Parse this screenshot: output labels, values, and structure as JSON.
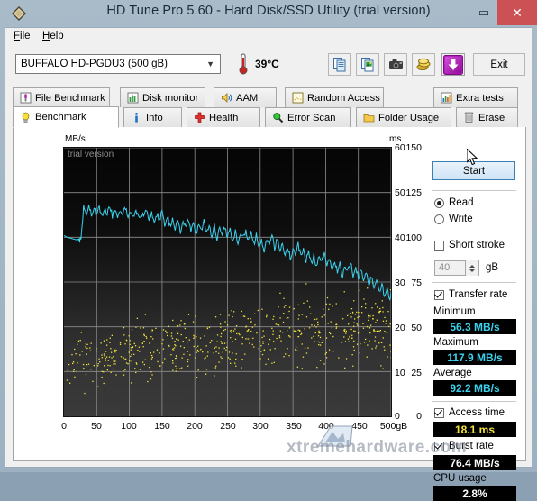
{
  "window": {
    "title": "HD Tune Pro 5.60 - Hard Disk/SSD Utility (trial version)",
    "app_icon": "diamond-icon",
    "minimize": "–",
    "maximize": "▭",
    "close": "✕"
  },
  "menu": {
    "items": [
      {
        "label": "File",
        "mnemonic": "F"
      },
      {
        "label": "Help",
        "mnemonic": "H"
      }
    ]
  },
  "toolbar": {
    "drive_selected": "BUFFALO HD-PGDU3 (500 gB)",
    "drive_chevron": "chevron-down-icon",
    "temperature": "39°C",
    "thermometer_icon": "thermometer-icon",
    "buttons": [
      {
        "name": "copy-text-icon",
        "tip": "Copy text"
      },
      {
        "name": "copy-image-icon",
        "tip": "Copy image"
      },
      {
        "name": "camera-icon",
        "tip": "Screenshot"
      },
      {
        "name": "coins-icon",
        "tip": "Buy"
      },
      {
        "name": "download-arrow-icon",
        "tip": "Download"
      }
    ],
    "exit_label": "Exit"
  },
  "tabs": {
    "row1": [
      {
        "label": "File Benchmark",
        "icon": "flask-icon",
        "active": false
      },
      {
        "label": "Disk monitor",
        "icon": "bar-chart-icon",
        "active": false
      },
      {
        "label": "AAM",
        "icon": "speaker-icon",
        "active": false
      },
      {
        "label": "Random Access",
        "icon": "dots-icon",
        "active": false
      },
      {
        "label": "Extra tests",
        "icon": "chart-icon",
        "active": false
      }
    ],
    "row2": [
      {
        "label": "Benchmark",
        "icon": "bulb-icon",
        "active": true
      },
      {
        "label": "Info",
        "icon": "info-icon",
        "active": false
      },
      {
        "label": "Health",
        "icon": "red-cross-icon",
        "active": false
      },
      {
        "label": "Error Scan",
        "icon": "magnifier-icon",
        "active": false
      },
      {
        "label": "Folder Usage",
        "icon": "folder-icon",
        "active": false
      },
      {
        "label": "Erase",
        "icon": "trash-icon",
        "active": false
      }
    ]
  },
  "controls": {
    "start_label": "Start",
    "mode": {
      "read_label": "Read",
      "write_label": "Write",
      "selected": "Read"
    },
    "short_stroke": {
      "label": "Short stroke",
      "checked": false,
      "size_value": "40",
      "size_unit": "gB"
    },
    "transfer_rate": {
      "label": "Transfer rate",
      "checked": true,
      "minimum_label": "Minimum",
      "minimum_value": "56.3 MB/s",
      "maximum_label": "Maximum",
      "maximum_value": "117.9 MB/s",
      "average_label": "Average",
      "average_value": "92.2 MB/s"
    },
    "access_time": {
      "label": "Access time",
      "checked": true,
      "value": "18.1 ms"
    },
    "burst_rate": {
      "label": "Burst rate",
      "checked": true,
      "value": "76.4 MB/s"
    },
    "cpu_usage": {
      "label": "CPU usage",
      "value": "2.8%"
    },
    "colors": {
      "transfer_rate": "#3ad2ee",
      "access_time": "#f5e43c",
      "burst_rate": "#ffffff",
      "cpu_usage": "#ffffff",
      "accent": "#3c7fb1",
      "close_button": "#cb5154"
    }
  },
  "watermark": {
    "plot_label": "trial version",
    "site": "xtremehardware.com"
  },
  "chart_data": {
    "type": "line",
    "title": "",
    "xlabel": "gB",
    "ylabel": "MB/s",
    "y2label": "ms",
    "xlim": [
      0,
      500
    ],
    "ylim": [
      0,
      150
    ],
    "y2lim": [
      0,
      60
    ],
    "grid": true,
    "x_ticks": [
      0,
      50,
      100,
      150,
      200,
      250,
      300,
      350,
      400,
      450,
      500
    ],
    "x_tick_labels": [
      "0",
      "50",
      "100",
      "150",
      "200",
      "250",
      "300",
      "350",
      "400",
      "450",
      "500gB"
    ],
    "y_ticks": [
      0,
      25,
      50,
      75,
      100,
      125,
      150
    ],
    "y_tick_labels": [
      "0",
      "25",
      "50",
      "75",
      "100",
      "125",
      "150"
    ],
    "y2_ticks": [
      0,
      10,
      20,
      30,
      40,
      50,
      60
    ],
    "y2_tick_labels": [
      "0",
      "10",
      "20",
      "30",
      "40",
      "50",
      "60"
    ],
    "legend_position": "none",
    "series": [
      {
        "name": "Transfer rate",
        "type": "line",
        "color": "#3ad2ee",
        "axis": "left",
        "unit": "MB/s",
        "x": [
          0,
          5,
          10,
          15,
          20,
          22,
          24,
          26,
          28,
          30,
          34,
          38,
          42,
          46,
          50,
          54,
          58,
          62,
          66,
          70,
          74,
          78,
          82,
          86,
          90,
          94,
          98,
          102,
          106,
          110,
          114,
          118,
          122,
          126,
          130,
          134,
          138,
          142,
          146,
          150,
          154,
          158,
          162,
          166,
          170,
          174,
          178,
          182,
          186,
          190,
          194,
          198,
          202,
          206,
          210,
          214,
          218,
          222,
          226,
          230,
          234,
          238,
          242,
          246,
          250,
          254,
          258,
          262,
          266,
          270,
          274,
          278,
          282,
          286,
          290,
          294,
          298,
          302,
          306,
          310,
          314,
          318,
          322,
          326,
          330,
          334,
          338,
          342,
          346,
          350,
          354,
          358,
          362,
          366,
          370,
          374,
          378,
          382,
          386,
          390,
          394,
          398,
          402,
          406,
          410,
          414,
          418,
          422,
          426,
          430,
          434,
          438,
          442,
          446,
          450,
          454,
          458,
          462,
          466,
          470,
          474,
          478,
          482,
          486,
          490,
          494,
          498,
          500
        ],
        "y": [
          101,
          100,
          99.5,
          99,
          98.5,
          99,
          98.5,
          99,
          106,
          117,
          112,
          117.5,
          113,
          116,
          111.5,
          117,
          112,
          116,
          113,
          117.5,
          112,
          116.5,
          111,
          115,
          113,
          117,
          111.5,
          114,
          112,
          116,
          111,
          113.5,
          112,
          115,
          110,
          114,
          108,
          113,
          110,
          114,
          107,
          112,
          106,
          111,
          104,
          110,
          103,
          109,
          106,
          110,
          104,
          108,
          101,
          107,
          104,
          109,
          102,
          107,
          100,
          106,
          99,
          105,
          102,
          106,
          100,
          104,
          98,
          103,
          97,
          102,
          100,
          104,
          98,
          102,
          96,
          101,
          94,
          99,
          92,
          98,
          96,
          101,
          94,
          99,
          92,
          97,
          90,
          95,
          88,
          94,
          91,
          96,
          89,
          94,
          87,
          92,
          85,
          90,
          83,
          89,
          86,
          91,
          84,
          89,
          82,
          87,
          80,
          85,
          78,
          84,
          81,
          86,
          79,
          84,
          77,
          82,
          75,
          80,
          73,
          78,
          71,
          76,
          69,
          74,
          67,
          72,
          65,
          70,
          63,
          68,
          61,
          66,
          59,
          64,
          58,
          62,
          57
        ]
      },
      {
        "name": "Access time",
        "type": "scatter",
        "color": "#f5e43c",
        "axis": "right",
        "unit": "ms",
        "description": "Scatter cloud of random access times, rising from about 6-16 ms near the start of the drive to about 16-27 ms toward the end, average 18.1 ms",
        "average": 18.1,
        "range": [
          5,
          30
        ]
      }
    ]
  }
}
